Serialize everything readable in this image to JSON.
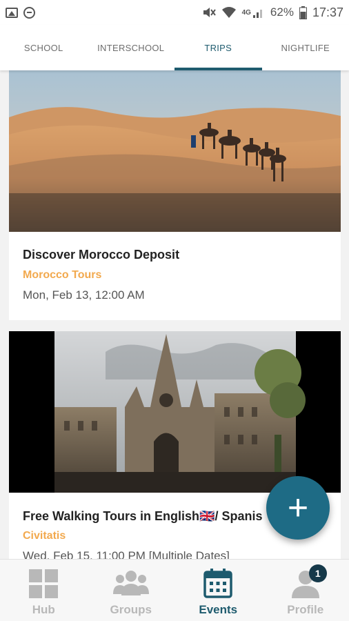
{
  "status_bar": {
    "battery_percent": "62%",
    "time": "17:37",
    "network": "4G",
    "icons": [
      "gallery-icon",
      "do-not-disturb-icon",
      "mute-icon",
      "wifi-icon",
      "signal-icon",
      "battery-icon"
    ]
  },
  "tabs": [
    {
      "label": "SCHOOL",
      "active": false
    },
    {
      "label": "INTERSCHOOL",
      "active": false
    },
    {
      "label": "TRIPS",
      "active": true
    },
    {
      "label": "NIGHTLIFE",
      "active": false
    }
  ],
  "events": [
    {
      "title": "Discover Morocco Deposit",
      "organizer": "Morocco Tours",
      "date": "Mon, Feb 13, 12:00 AM",
      "image": "desert-camel-caravan-image"
    },
    {
      "title": "Free Walking Tours in English🇬🇧/ Spanis",
      "organizer": "Civitatis",
      "date": "Wed, Feb 15, 11:00 PM  [Multiple Dates]",
      "image": "barcelona-cathedral-image"
    }
  ],
  "fab": {
    "symbol": "+",
    "icon": "plus-icon"
  },
  "bottom_nav": [
    {
      "label": "Hub",
      "icon": "grid-icon",
      "active": false
    },
    {
      "label": "Groups",
      "icon": "groups-icon",
      "active": false
    },
    {
      "label": "Events",
      "icon": "calendar-icon",
      "active": true
    },
    {
      "label": "Profile",
      "icon": "profile-icon",
      "active": false,
      "badge": "1"
    }
  ],
  "colors": {
    "accent": "#1e5b6e",
    "fab": "#1e6b85",
    "organizer": "#f2a94e",
    "inactive_nav": "#b8b8b8"
  }
}
